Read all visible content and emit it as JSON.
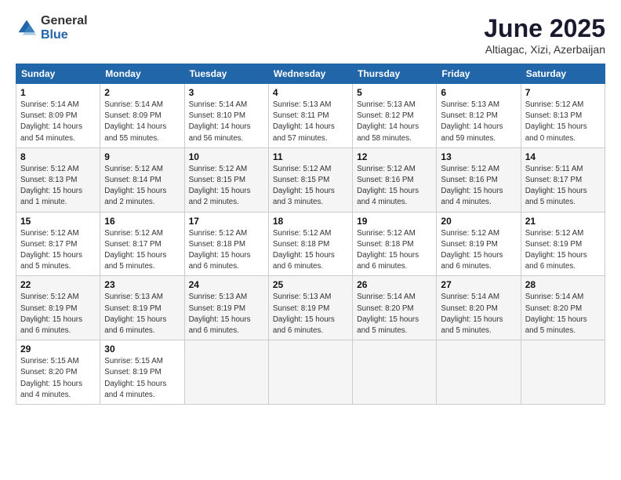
{
  "logo": {
    "general": "General",
    "blue": "Blue"
  },
  "title": "June 2025",
  "location": "Altiagac, Xizi, Azerbaijan",
  "weekdays": [
    "Sunday",
    "Monday",
    "Tuesday",
    "Wednesday",
    "Thursday",
    "Friday",
    "Saturday"
  ],
  "weeks": [
    [
      {
        "day": "1",
        "sunrise": "5:14 AM",
        "sunset": "8:09 PM",
        "daylight": "14 hours and 54 minutes."
      },
      {
        "day": "2",
        "sunrise": "5:14 AM",
        "sunset": "8:09 PM",
        "daylight": "14 hours and 55 minutes."
      },
      {
        "day": "3",
        "sunrise": "5:14 AM",
        "sunset": "8:10 PM",
        "daylight": "14 hours and 56 minutes."
      },
      {
        "day": "4",
        "sunrise": "5:13 AM",
        "sunset": "8:11 PM",
        "daylight": "14 hours and 57 minutes."
      },
      {
        "day": "5",
        "sunrise": "5:13 AM",
        "sunset": "8:12 PM",
        "daylight": "14 hours and 58 minutes."
      },
      {
        "day": "6",
        "sunrise": "5:13 AM",
        "sunset": "8:12 PM",
        "daylight": "14 hours and 59 minutes."
      },
      {
        "day": "7",
        "sunrise": "5:12 AM",
        "sunset": "8:13 PM",
        "daylight": "15 hours and 0 minutes."
      }
    ],
    [
      {
        "day": "8",
        "sunrise": "5:12 AM",
        "sunset": "8:13 PM",
        "daylight": "15 hours and 1 minute."
      },
      {
        "day": "9",
        "sunrise": "5:12 AM",
        "sunset": "8:14 PM",
        "daylight": "15 hours and 2 minutes."
      },
      {
        "day": "10",
        "sunrise": "5:12 AM",
        "sunset": "8:15 PM",
        "daylight": "15 hours and 2 minutes."
      },
      {
        "day": "11",
        "sunrise": "5:12 AM",
        "sunset": "8:15 PM",
        "daylight": "15 hours and 3 minutes."
      },
      {
        "day": "12",
        "sunrise": "5:12 AM",
        "sunset": "8:16 PM",
        "daylight": "15 hours and 4 minutes."
      },
      {
        "day": "13",
        "sunrise": "5:12 AM",
        "sunset": "8:16 PM",
        "daylight": "15 hours and 4 minutes."
      },
      {
        "day": "14",
        "sunrise": "5:11 AM",
        "sunset": "8:17 PM",
        "daylight": "15 hours and 5 minutes."
      }
    ],
    [
      {
        "day": "15",
        "sunrise": "5:12 AM",
        "sunset": "8:17 PM",
        "daylight": "15 hours and 5 minutes."
      },
      {
        "day": "16",
        "sunrise": "5:12 AM",
        "sunset": "8:17 PM",
        "daylight": "15 hours and 5 minutes."
      },
      {
        "day": "17",
        "sunrise": "5:12 AM",
        "sunset": "8:18 PM",
        "daylight": "15 hours and 6 minutes."
      },
      {
        "day": "18",
        "sunrise": "5:12 AM",
        "sunset": "8:18 PM",
        "daylight": "15 hours and 6 minutes."
      },
      {
        "day": "19",
        "sunrise": "5:12 AM",
        "sunset": "8:18 PM",
        "daylight": "15 hours and 6 minutes."
      },
      {
        "day": "20",
        "sunrise": "5:12 AM",
        "sunset": "8:19 PM",
        "daylight": "15 hours and 6 minutes."
      },
      {
        "day": "21",
        "sunrise": "5:12 AM",
        "sunset": "8:19 PM",
        "daylight": "15 hours and 6 minutes."
      }
    ],
    [
      {
        "day": "22",
        "sunrise": "5:12 AM",
        "sunset": "8:19 PM",
        "daylight": "15 hours and 6 minutes."
      },
      {
        "day": "23",
        "sunrise": "5:13 AM",
        "sunset": "8:19 PM",
        "daylight": "15 hours and 6 minutes."
      },
      {
        "day": "24",
        "sunrise": "5:13 AM",
        "sunset": "8:19 PM",
        "daylight": "15 hours and 6 minutes."
      },
      {
        "day": "25",
        "sunrise": "5:13 AM",
        "sunset": "8:19 PM",
        "daylight": "15 hours and 6 minutes."
      },
      {
        "day": "26",
        "sunrise": "5:14 AM",
        "sunset": "8:20 PM",
        "daylight": "15 hours and 5 minutes."
      },
      {
        "day": "27",
        "sunrise": "5:14 AM",
        "sunset": "8:20 PM",
        "daylight": "15 hours and 5 minutes."
      },
      {
        "day": "28",
        "sunrise": "5:14 AM",
        "sunset": "8:20 PM",
        "daylight": "15 hours and 5 minutes."
      }
    ],
    [
      {
        "day": "29",
        "sunrise": "5:15 AM",
        "sunset": "8:20 PM",
        "daylight": "15 hours and 4 minutes."
      },
      {
        "day": "30",
        "sunrise": "5:15 AM",
        "sunset": "8:19 PM",
        "daylight": "15 hours and 4 minutes."
      },
      null,
      null,
      null,
      null,
      null
    ]
  ]
}
